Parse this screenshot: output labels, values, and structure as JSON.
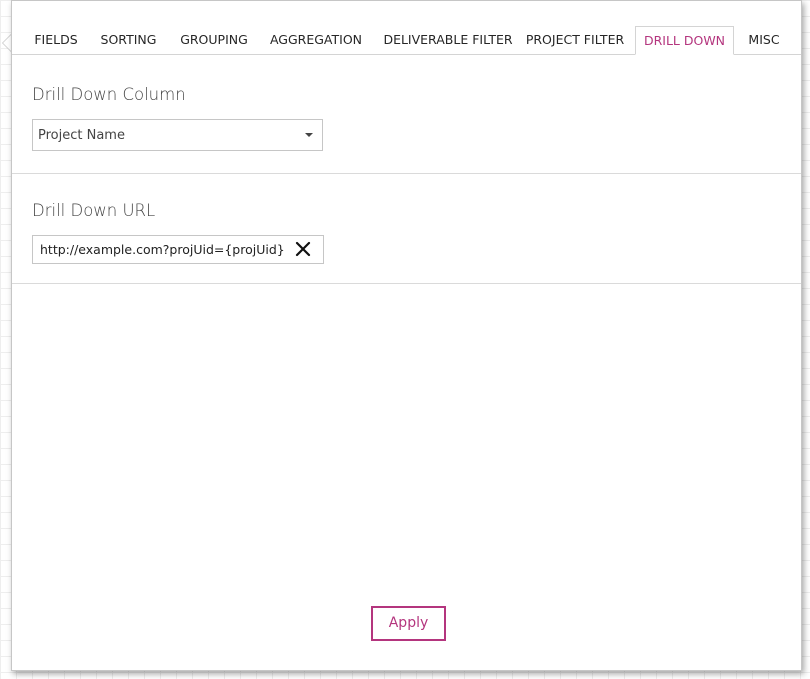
{
  "tabs": [
    {
      "label": "FIELDS"
    },
    {
      "label": "SORTING"
    },
    {
      "label": "GROUPING"
    },
    {
      "label": "AGGREGATION"
    },
    {
      "label": "DELIVERABLE FILTER"
    },
    {
      "label": "PROJECT FILTER"
    },
    {
      "label": "DRILL DOWN",
      "active": true
    },
    {
      "label": "MISC"
    }
  ],
  "drill_down_column": {
    "title": "Drill Down Column",
    "selected": "Project Name"
  },
  "drill_down_url": {
    "title": "Drill Down URL",
    "value": "http://example.com?projUid={projUid}"
  },
  "apply_label": "Apply",
  "colors": {
    "accent": "#b4357e",
    "text": "#444444",
    "border": "#c6c6c6"
  },
  "icons": {
    "clear": "close-x-icon",
    "dropdown": "chevron-down-icon"
  }
}
